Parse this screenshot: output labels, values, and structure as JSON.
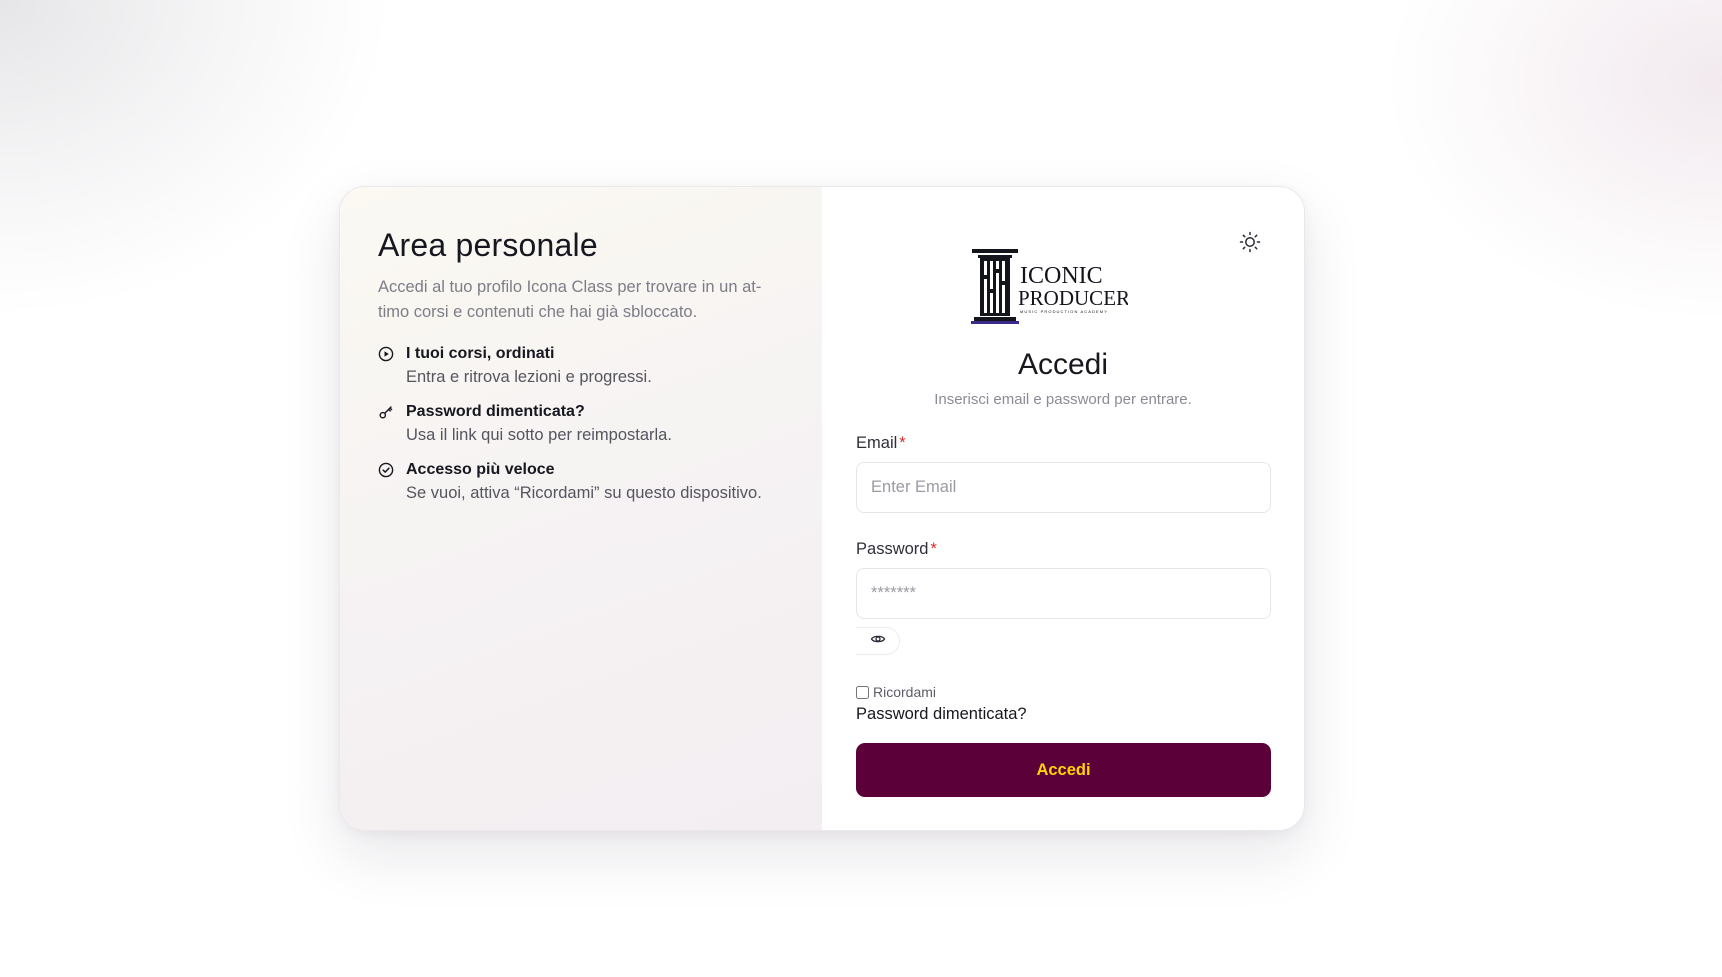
{
  "left": {
    "title": "Area personale",
    "intro": "Accedi al tuo profilo Icona Class per trovare in un at-timo corsi e contenuti che hai già sbloccato.",
    "features": [
      {
        "icon": "play-circle-icon",
        "title": "I tuoi corsi, ordinati",
        "desc": "Entra e ritrova lezioni e progressi."
      },
      {
        "icon": "key-icon",
        "title": "Password dimenticata?",
        "desc": "Usa il link qui sotto per reimpostarla."
      },
      {
        "icon": "check-circle-icon",
        "title": "Accesso più veloce",
        "desc": "Se vuoi, attiva “Ricordami” su questo dispositivo."
      }
    ]
  },
  "logo": {
    "line1": "ICONIC",
    "line2": "PRODUCER",
    "tagline": "MUSIC PRODUCTION ACADEMY"
  },
  "form": {
    "title": "Accedi",
    "subtitle": "Inserisci email e password per entrare.",
    "email_label": "Email",
    "email_placeholder": "Enter Email",
    "password_label": "Password",
    "password_placeholder": "*******",
    "required_mark": "*",
    "remember_label": "Ricordami",
    "forgot_link": "Password dimenticata?",
    "submit_label": "Accedi"
  },
  "colors": {
    "brand": "#5c003a",
    "submit_text": "#ffd400",
    "required": "#d62c2c"
  },
  "icons": {
    "theme_toggle": "sun-icon",
    "password_toggle": "eye-icon"
  }
}
